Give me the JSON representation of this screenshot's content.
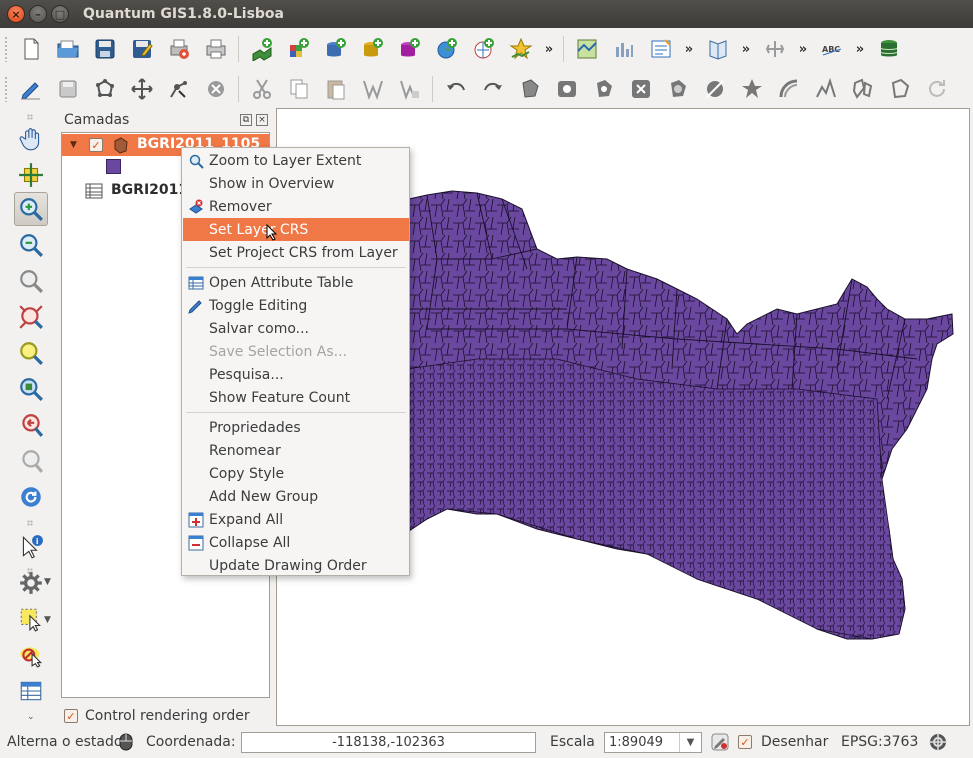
{
  "window": {
    "title": "Quantum GIS1.8.0-Lisboa"
  },
  "toolbar1": {
    "buttons": [
      "new-project",
      "open-project",
      "save-project",
      "save-as-project",
      "print-composer",
      "print",
      "add-vector-layer",
      "add-raster-layer",
      "add-postgis-layer",
      "add-spatialite-layer",
      "add-mssql-layer",
      "add-wms-layer",
      "add-wfs-layer",
      "new-shapefile"
    ],
    "ext_label": "»"
  },
  "toolbar2": {
    "buttons": [
      "toggle-editing",
      "save-edits",
      "add-feature",
      "move-feature",
      "node-tool",
      "delete-selected",
      "cut-features",
      "copy-features",
      "paste-features",
      "add-ring",
      "add-part",
      "undo",
      "redo",
      "simplify",
      "fill-ring",
      "delete-ring",
      "delete-part",
      "reshape",
      "split",
      "merge",
      "rotate-point",
      "offset-curve",
      "split-parts",
      "rotate",
      "reshape-features",
      "rotate-label"
    ]
  },
  "layers_panel": {
    "title": "Camadas",
    "layers": [
      {
        "name": "BGRI2011_1105",
        "checked": true,
        "selected": true,
        "color": "#6b48a0"
      },
      {
        "name": "BGRI2011",
        "checked": false,
        "selected": false
      }
    ],
    "footer_label": "Control rendering order",
    "footer_checked": true
  },
  "context_menu": {
    "items": [
      {
        "label": "Zoom to Layer Extent",
        "icon": "zoom-layer-icon",
        "state": "normal"
      },
      {
        "label": "Show in Overview",
        "icon": "",
        "state": "normal"
      },
      {
        "label": "Remover",
        "icon": "remove-layer-icon",
        "state": "normal"
      },
      {
        "label": "Set Layer CRS",
        "icon": "",
        "state": "highlighted"
      },
      {
        "label": "Set Project CRS from Layer",
        "icon": "",
        "state": "normal"
      },
      {
        "separator": true
      },
      {
        "label": "Open Attribute Table",
        "icon": "attribute-table-icon",
        "state": "normal"
      },
      {
        "label": "Toggle Editing",
        "icon": "pencil-icon",
        "state": "normal"
      },
      {
        "label": "Salvar como...",
        "icon": "",
        "state": "normal"
      },
      {
        "label": "Save Selection As...",
        "icon": "",
        "state": "disabled"
      },
      {
        "label": "Pesquisa...",
        "icon": "",
        "state": "normal"
      },
      {
        "label": "Show Feature Count",
        "icon": "",
        "state": "normal"
      },
      {
        "separator": true
      },
      {
        "label": "Propriedades",
        "icon": "",
        "state": "normal"
      },
      {
        "label": "Renomear",
        "icon": "",
        "state": "normal"
      },
      {
        "label": "Copy Style",
        "icon": "",
        "state": "normal"
      },
      {
        "label": "Add New Group",
        "icon": "",
        "state": "normal"
      },
      {
        "label": "Expand All",
        "icon": "expand-all-icon",
        "state": "normal"
      },
      {
        "label": "Collapse All",
        "icon": "collapse-all-icon",
        "state": "normal"
      },
      {
        "label": "Update Drawing Order",
        "icon": "",
        "state": "normal"
      }
    ]
  },
  "map": {
    "fill_color": "#6b48a0",
    "outline_color": "#1a0f2a"
  },
  "statusbar": {
    "toggle_label": "Alterna o estado",
    "coord_label": "Coordenada:",
    "coord_value": "-118138,-102363",
    "scale_label": "Escala",
    "scale_value": "1:89049",
    "render_label": "Desenhar",
    "render_checked": true,
    "crs_label": "EPSG:3763"
  },
  "colors": {
    "accent": "#f07746",
    "titlebar": "#3d3c38",
    "background": "#f2f1f0",
    "layer_fill": "#6b48a0"
  }
}
